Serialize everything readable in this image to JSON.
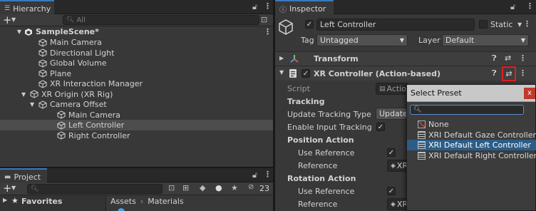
{
  "hierarchy": {
    "tab_label": "Hierarchy",
    "search_placeholder": "All",
    "scene_name": "SampleScene*",
    "items": [
      {
        "label": "Main Camera",
        "icon": "cube-icon"
      },
      {
        "label": "Directional Light",
        "icon": "cube-icon"
      },
      {
        "label": "Global Volume",
        "icon": "cube-icon"
      },
      {
        "label": "Plane",
        "icon": "cube-icon"
      },
      {
        "label": "XR Interaction Manager",
        "icon": "cube-icon"
      },
      {
        "label": "XR Origin (XR Rig)",
        "icon": "cube-icon"
      },
      {
        "label": "Camera Offset",
        "icon": "cube-icon"
      },
      {
        "label": "Main Camera",
        "icon": "cube-icon"
      },
      {
        "label": "Left Controller",
        "icon": "cube-icon",
        "selected": true
      },
      {
        "label": "Right Controller",
        "icon": "cube-icon"
      }
    ]
  },
  "project": {
    "tab_label": "Project",
    "favorites_label": "Favorites",
    "breadcrumb": [
      "Assets",
      "Materials"
    ],
    "hidden_count": "23"
  },
  "inspector": {
    "tab_label": "Inspector",
    "object_name": "Left Controller",
    "static_label": "Static",
    "tag_label": "Tag",
    "tag_value": "Untagged",
    "layer_label": "Layer",
    "layer_value": "Default",
    "transform_label": "Transform",
    "component_label": "XR Controller (Action-based)",
    "script_label": "Script",
    "script_value": "Actio",
    "tracking_header": "Tracking",
    "update_tracking_type_label": "Update Tracking Type",
    "update_tracking_type_value": "Update",
    "enable_input_tracking_label": "Enable Input Tracking",
    "position_action_header": "Position Action",
    "use_reference_label": "Use Reference",
    "reference_label": "Reference",
    "reference_value": "XR",
    "rotation_action_header": "Rotation Action",
    "use_reference_label_2": "Use Reference",
    "reference_label_2": "Reference",
    "reference_value_2": "XR"
  },
  "preset_popup": {
    "title": "Select Preset",
    "close_label": "x",
    "options": [
      {
        "label": "None",
        "icon": "none-icon"
      },
      {
        "label": "XRI Default Gaze Controller",
        "icon": "preset-icon"
      },
      {
        "label": "XRI Default Left Controller",
        "icon": "preset-icon",
        "selected": true
      },
      {
        "label": "XRI Default Right Controller",
        "icon": "preset-icon"
      }
    ]
  },
  "colors": {
    "accent": "#3a79bb",
    "selection": "#2c5d87",
    "highlight_box": "#e02020",
    "close_button": "#c0392b"
  }
}
